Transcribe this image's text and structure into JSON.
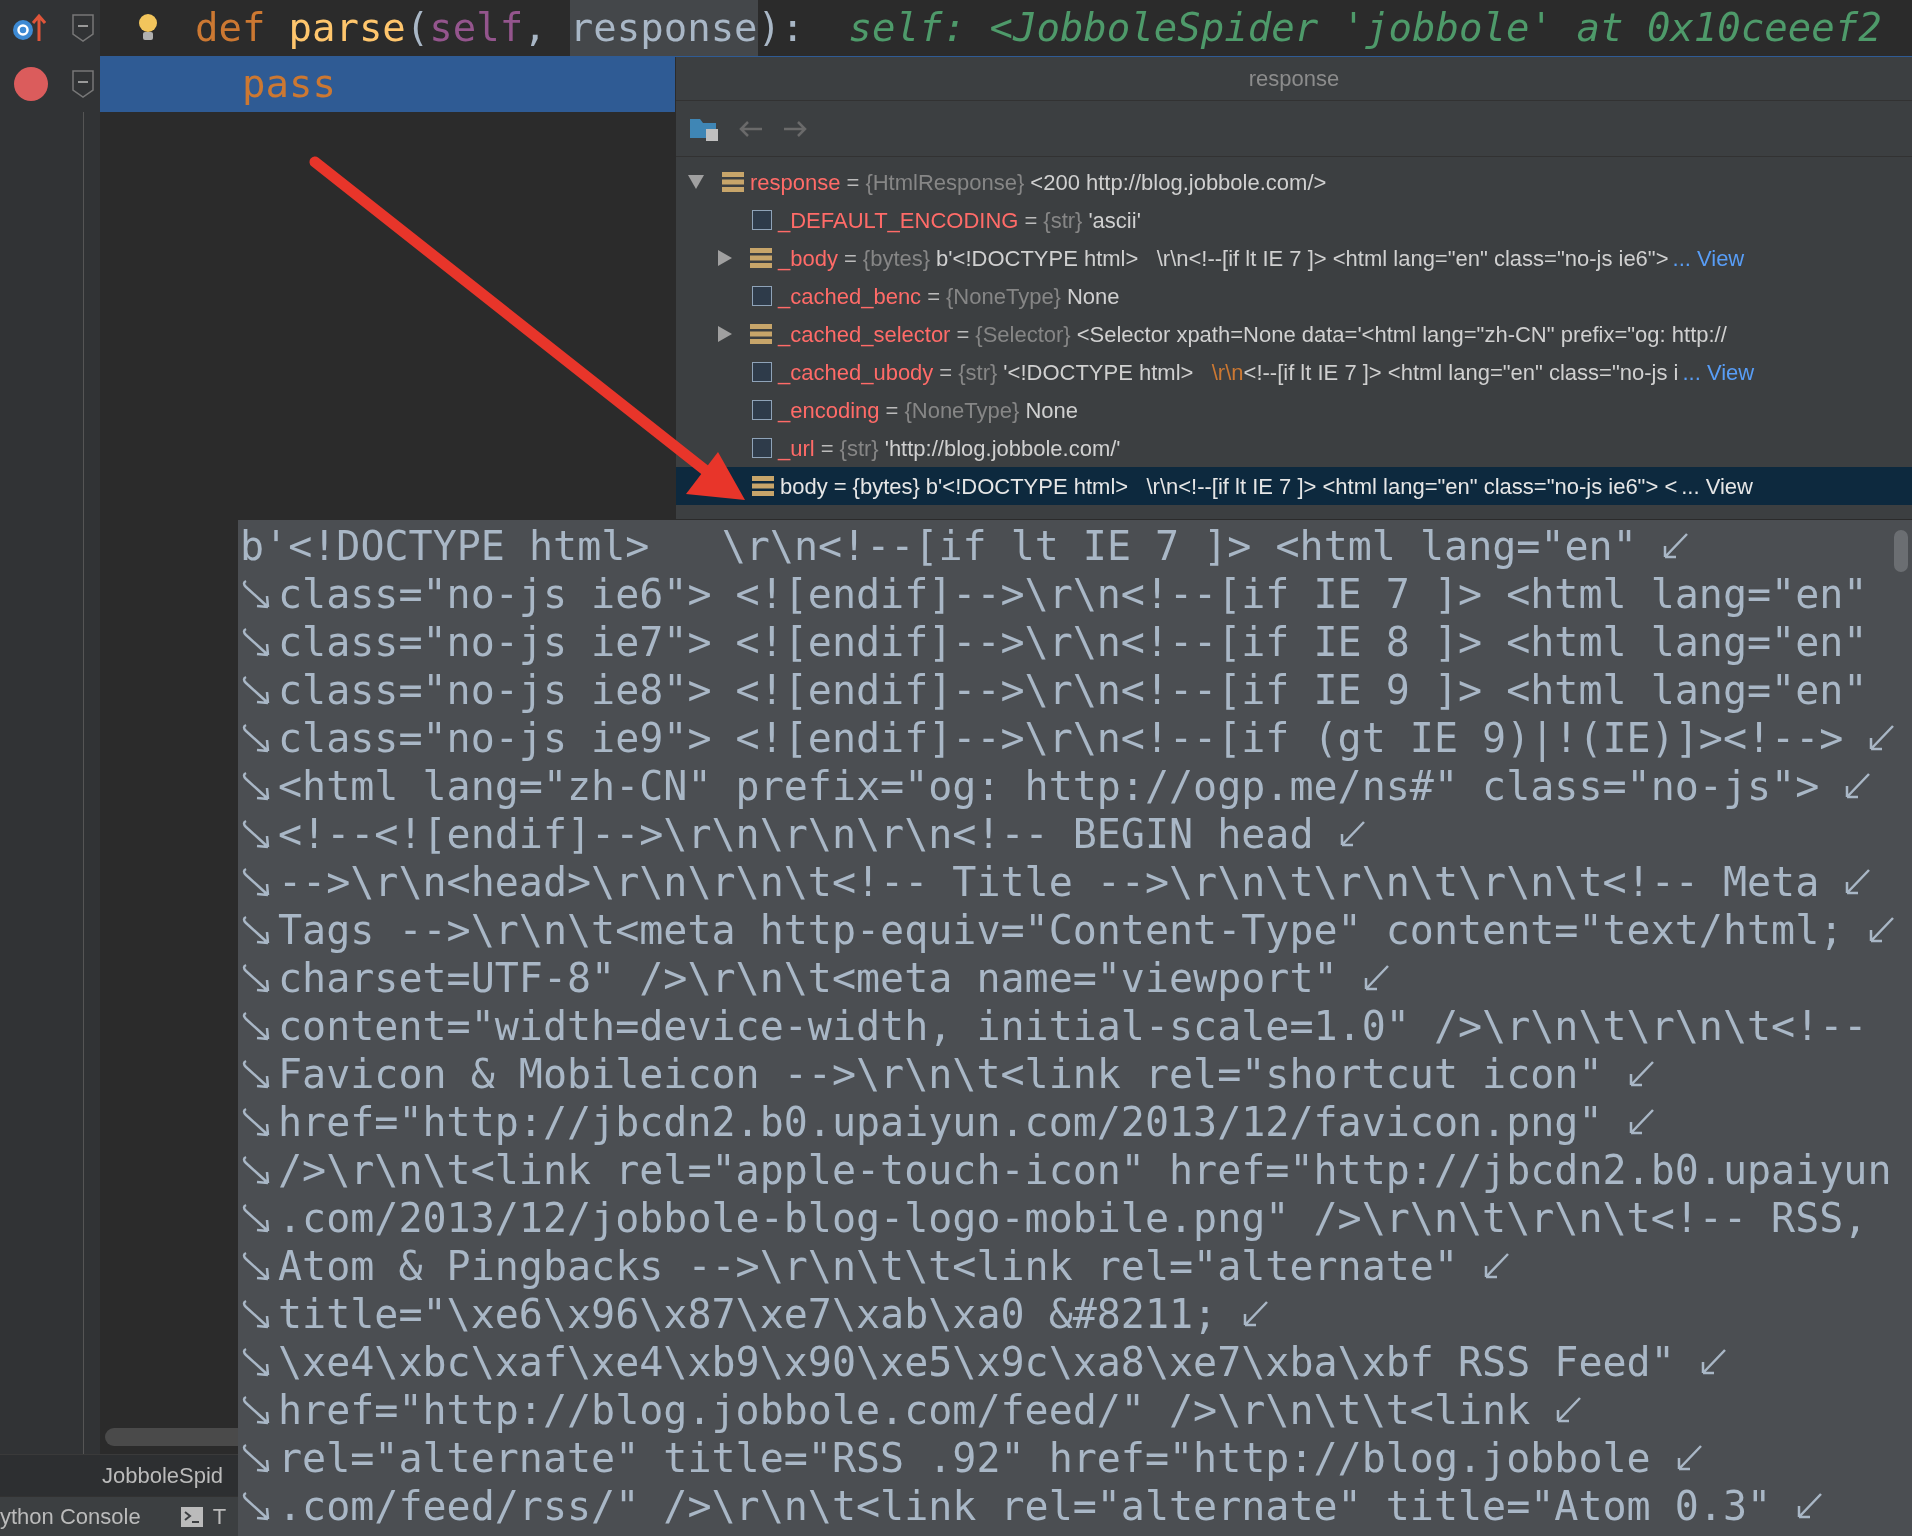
{
  "editor": {
    "lines": [
      {
        "current": false,
        "breakpoint": false,
        "tokens": [
          {
            "text": "def",
            "kind": "keyword"
          },
          {
            "text": "parse",
            "kind": "function"
          },
          {
            "text": "(",
            "kind": "punct"
          },
          {
            "text": "self",
            "kind": "self"
          },
          {
            "text": ",",
            "kind": "comma"
          },
          {
            "text": "response",
            "kind": "usage"
          },
          {
            "text": "):",
            "kind": "punct"
          },
          {
            "text": "self: <JobboleSpider 'jobbole' at 0x10ceeef2",
            "kind": "hint"
          }
        ]
      },
      {
        "current": true,
        "breakpoint": true,
        "tokens": [
          {
            "text": "pass",
            "kind": "statement"
          }
        ]
      }
    ]
  },
  "breadcrumb": "JobboleSpid",
  "tool_tabs": [
    {
      "label": "ython Console",
      "kind": "console"
    },
    {
      "label": "T",
      "kind": "terminal"
    }
  ],
  "variables_popup": {
    "title": "response",
    "tree": [
      {
        "name": "response",
        "sep": "=",
        "type": "{HtmlResponse}",
        "value": [
          {
            "text": "<200 http://blog.jobbole.com/>",
            "highlight": false
          }
        ],
        "kind": "object",
        "expanded": true,
        "selected": false,
        "children": [
          {
            "name": "_DEFAULT_ENCODING",
            "sep": "=",
            "type": "{str}",
            "value": [
              {
                "text": "'ascii'",
                "highlight": false
              }
            ],
            "kind": "scalar",
            "selected": false
          },
          {
            "name": "_body",
            "sep": "=",
            "type": "{bytes}",
            "value": [
              {
                "text": "b'<!DOCTYPE html>   \\r\\n<!--[if lt IE 7 ]> <html lang=\"en\" class=\"no-js ie6\">",
                "highlight": false
              }
            ],
            "link": "... View",
            "kind": "object",
            "expanded": false,
            "selected": false
          },
          {
            "name": "_cached_benc",
            "sep": "=",
            "type": "{NoneType}",
            "value": [
              {
                "text": "None",
                "highlight": false
              }
            ],
            "kind": "scalar",
            "selected": false
          },
          {
            "name": "_cached_selector",
            "sep": "=",
            "type": "{Selector}",
            "value": [
              {
                "text": "<Selector xpath=None data='<html lang=\"zh-CN\" prefix=\"og: http://",
                "highlight": false
              }
            ],
            "kind": "object",
            "expanded": false,
            "selected": false
          },
          {
            "name": "_cached_ubody",
            "sep": "=",
            "type": "{str}",
            "value": [
              {
                "text": "'<!DOCTYPE html>   ",
                "highlight": false
              },
              {
                "text": "\\r\\n",
                "highlight": true
              },
              {
                "text": "<!--[if lt IE 7 ]> <html lang=\"en\" class=\"no-js i",
                "highlight": false
              }
            ],
            "link": "... View",
            "kind": "scalar",
            "selected": false
          },
          {
            "name": "_encoding",
            "sep": "=",
            "type": "{NoneType}",
            "value": [
              {
                "text": "None",
                "highlight": false
              }
            ],
            "kind": "scalar",
            "selected": false
          },
          {
            "name": "_url",
            "sep": "=",
            "type": "{str}",
            "value": [
              {
                "text": "'http://blog.jobbole.com/'",
                "highlight": false
              }
            ],
            "kind": "scalar",
            "selected": false
          },
          {
            "name": "body",
            "sep": "=",
            "type": "{bytes}",
            "value": [
              {
                "text": "b'<!DOCTYPE html>   \\r\\n<!--[if lt IE 7 ]> <html lang=\"en\" class=\"no-js ie6\"> <",
                "highlight": false
              }
            ],
            "link": "... View",
            "kind": "bytes",
            "selected": true
          }
        ]
      }
    ]
  },
  "value_popup": {
    "lines": [
      {
        "text": "b'<!DOCTYPE html>   \\r\\n<!--[if lt IE 7 ]> <html lang=\"en\"",
        "wrap_in": false,
        "wrap_out": true
      },
      {
        "text": "class=\"no-js ie6\"> <![endif]-->\\r\\n<!--[if IE 7 ]> <html lang=\"en\"",
        "wrap_in": true,
        "wrap_out": false
      },
      {
        "text": "class=\"no-js ie7\"> <![endif]-->\\r\\n<!--[if IE 8 ]> <html lang=\"en\"",
        "wrap_in": true,
        "wrap_out": false
      },
      {
        "text": "class=\"no-js ie8\"> <![endif]-->\\r\\n<!--[if IE 9 ]> <html lang=\"en\"",
        "wrap_in": true,
        "wrap_out": false
      },
      {
        "text": "class=\"no-js ie9\"> <![endif]-->\\r\\n<!--[if (gt IE 9)|!(IE)]><!-->",
        "wrap_in": true,
        "wrap_out": true
      },
      {
        "text": "<html lang=\"zh-CN\" prefix=\"og: http://ogp.me/ns#\" class=\"no-js\">",
        "wrap_in": true,
        "wrap_out": true
      },
      {
        "text": "<!--<![endif]-->\\r\\n\\r\\n\\r\\n<!-- BEGIN head",
        "wrap_in": true,
        "wrap_out": true
      },
      {
        "text": "-->\\r\\n<head>\\r\\n\\r\\n\\t<!-- Title -->\\r\\n\\t\\r\\n\\t\\r\\n\\t<!-- Meta",
        "wrap_in": true,
        "wrap_out": true
      },
      {
        "text": "Tags -->\\r\\n\\t<meta http-equiv=\"Content-Type\" content=\"text/html;",
        "wrap_in": true,
        "wrap_out": true
      },
      {
        "text": "charset=UTF-8\" />\\r\\n\\t<meta name=\"viewport\"",
        "wrap_in": true,
        "wrap_out": true
      },
      {
        "text": "content=\"width=device-width, initial-scale=1.0\" />\\r\\n\\t\\r\\n\\t<!--",
        "wrap_in": true,
        "wrap_out": false
      },
      {
        "text": "Favicon & Mobileicon -->\\r\\n\\t<link rel=\"shortcut icon\"",
        "wrap_in": true,
        "wrap_out": true
      },
      {
        "text": "href=\"http://jbcdn2.b0.upaiyun.com/2013/12/favicon.png\"",
        "wrap_in": true,
        "wrap_out": true
      },
      {
        "text": "/>\\r\\n\\t<link rel=\"apple-touch-icon\" href=\"http://jbcdn2.b0.upaiyun",
        "wrap_in": true,
        "wrap_out": false
      },
      {
        "text": ".com/2013/12/jobbole-blog-logo-mobile.png\" />\\r\\n\\t\\r\\n\\t<!-- RSS,",
        "wrap_in": true,
        "wrap_out": false
      },
      {
        "text": "Atom & Pingbacks -->\\r\\n\\t\\t<link rel=\"alternate\"",
        "wrap_in": true,
        "wrap_out": true
      },
      {
        "text": "title=\"\\xe6\\x96\\x87\\xe7\\xab\\xa0 &#8211;",
        "wrap_in": true,
        "wrap_out": true
      },
      {
        "text": "\\xe4\\xbc\\xaf\\xe4\\xb9\\x90\\xe5\\x9c\\xa8\\xe7\\xba\\xbf RSS Feed\"",
        "wrap_in": true,
        "wrap_out": true
      },
      {
        "text": "href=\"http://blog.jobbole.com/feed/\" />\\r\\n\\t\\t<link",
        "wrap_in": true,
        "wrap_out": true
      },
      {
        "text": "rel=\"alternate\" title=\"RSS .92\" href=\"http://blog.jobbole",
        "wrap_in": true,
        "wrap_out": true
      },
      {
        "text": ".com/feed/rss/\" />\\r\\n\\t<link rel=\"alternate\" title=\"Atom 0.3\"",
        "wrap_in": true,
        "wrap_out": true
      }
    ]
  }
}
